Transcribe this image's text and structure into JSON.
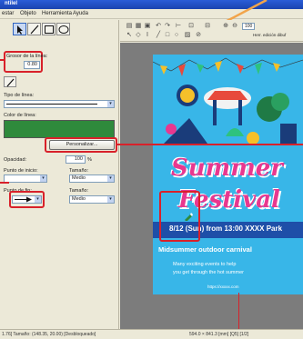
{
  "window": {
    "title": "ntilel"
  },
  "menu": [
    "estar",
    "Objeto",
    "Herramienta",
    "Ayuda"
  ],
  "left_panel": {
    "line_width_label": "Grosor de la línea:",
    "line_width_value": "0.80",
    "line_type_label": "Tipo de línea:",
    "line_color_label": "Color de línea:",
    "customize_button": "Personalizar...",
    "opacity_label": "Opacidad:",
    "opacity_value": "100",
    "opacity_unit": "%",
    "start_point_label": "Punto de inicio:",
    "start_size_label": "Tamaño:",
    "start_size_value": "Medio",
    "end_point_label": "Punto de fin:",
    "end_size_label": "Tamaño:",
    "end_size_value": "Medio",
    "line_color": "#2f8a3c"
  },
  "toolbar": {
    "zoom_label": "100",
    "mode_label": "Herr. edición dibuf"
  },
  "poster": {
    "title_line1": "Summer",
    "title_line2": "Festival",
    "date_text": "8/12 (Sun) from 13:00  XXXX Park",
    "subtitle": "Midsummer outdoor carnival",
    "desc_line1": "Many exciting events to help",
    "desc_line2": "you get through the hot summer",
    "url": "https://xxxxx.com"
  },
  "status": {
    "left": "1.76] Tamaño: (148.35, 20.00) [Desbloqueado]",
    "right": "594.0 × 841.3 [mm] [Q5]  [1/2]"
  },
  "colors": {
    "highlight": "#d8212a",
    "accent_pink": "#e8388f",
    "poster_bg": "#38b6e8"
  }
}
